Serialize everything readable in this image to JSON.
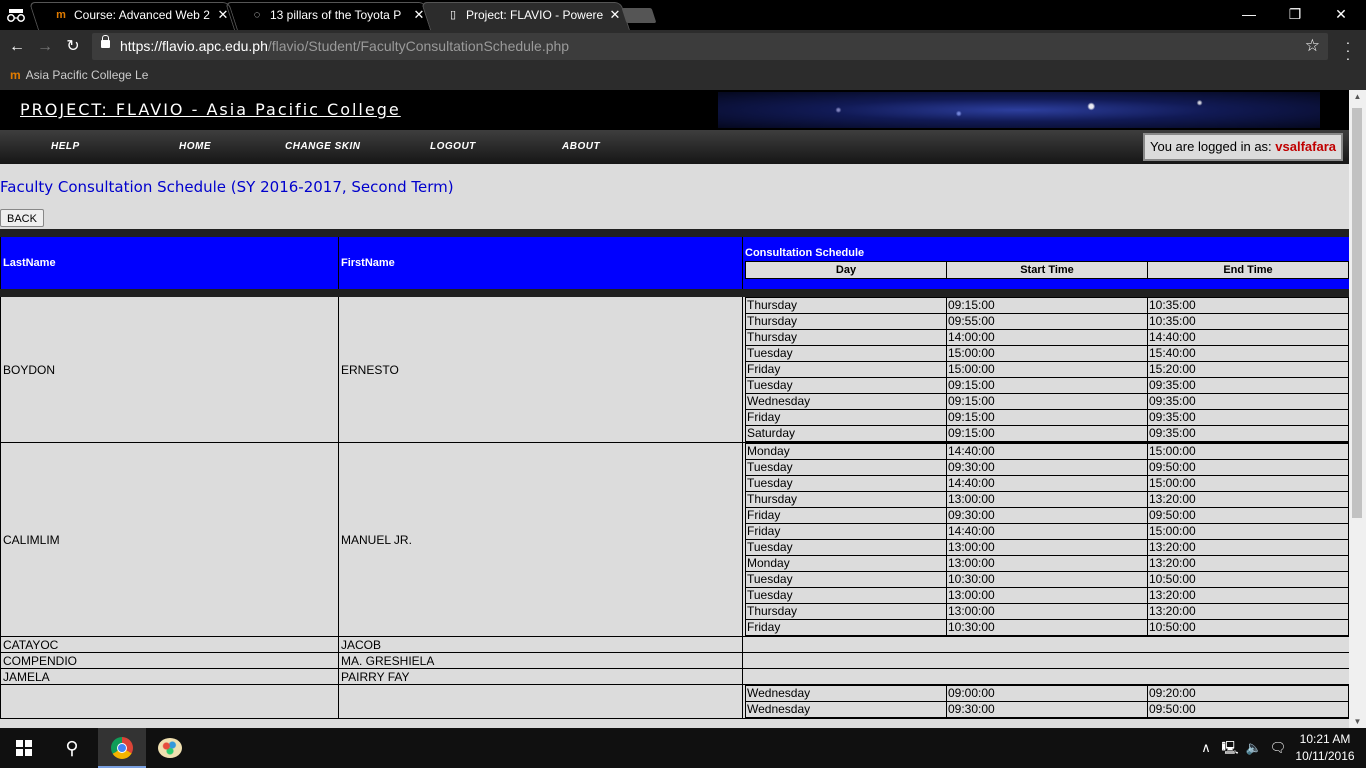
{
  "browser": {
    "tabs": [
      {
        "title": "Course: Advanced Web 2",
        "favicon": "moodle-icon"
      },
      {
        "title": "13 pillars of the Toyota P",
        "favicon": "loading-icon"
      },
      {
        "title": "Project: FLAVIO - Powere",
        "favicon": "page-icon"
      }
    ],
    "url_host": "https://flavio.apc.edu.ph",
    "url_path": "/flavio/Student/FacultyConsultationSchedule.php",
    "bookmark": "Asia Pacific College Le"
  },
  "site": {
    "title": "PROJECT: FLAVIO - Asia Pacific College",
    "nav": [
      "HELP",
      "HOME",
      "CHANGE SKIN",
      "LOGOUT",
      "ABOUT"
    ],
    "logged_label": "You are logged in as:",
    "username": "vsalfafara"
  },
  "page": {
    "heading": "Faculty Consultation Schedule (SY 2016-2017, Second Term)",
    "back_label": "BACK",
    "columns": {
      "last": "LastName",
      "first": "FirstName",
      "schedule": "Consultation Schedule"
    },
    "subcolumns": [
      "Day",
      "Start Time",
      "End Time"
    ]
  },
  "faculty": [
    {
      "last": "BOYDON",
      "first": "ERNESTO",
      "schedule": [
        [
          "Thursday",
          "09:15:00",
          "10:35:00"
        ],
        [
          "Thursday",
          "09:55:00",
          "10:35:00"
        ],
        [
          "Thursday",
          "14:00:00",
          "14:40:00"
        ],
        [
          "Tuesday",
          "15:00:00",
          "15:40:00"
        ],
        [
          "Friday",
          "15:00:00",
          "15:20:00"
        ],
        [
          "Tuesday",
          "09:15:00",
          "09:35:00"
        ],
        [
          "Wednesday",
          "09:15:00",
          "09:35:00"
        ],
        [
          "Friday",
          "09:15:00",
          "09:35:00"
        ],
        [
          "Saturday",
          "09:15:00",
          "09:35:00"
        ]
      ]
    },
    {
      "last": "CALIMLIM",
      "first": "MANUEL JR.",
      "schedule": [
        [
          "Monday",
          "14:40:00",
          "15:00:00"
        ],
        [
          "Tuesday",
          "09:30:00",
          "09:50:00"
        ],
        [
          "Tuesday",
          "14:40:00",
          "15:00:00"
        ],
        [
          "Thursday",
          "13:00:00",
          "13:20:00"
        ],
        [
          "Friday",
          "09:30:00",
          "09:50:00"
        ],
        [
          "Friday",
          "14:40:00",
          "15:00:00"
        ],
        [
          "Tuesday",
          "13:00:00",
          "13:20:00"
        ],
        [
          "Monday",
          "13:00:00",
          "13:20:00"
        ],
        [
          "Tuesday",
          "10:30:00",
          "10:50:00"
        ],
        [
          "Tuesday",
          "13:00:00",
          "13:20:00"
        ],
        [
          "Thursday",
          "13:00:00",
          "13:20:00"
        ],
        [
          "Friday",
          "10:30:00",
          "10:50:00"
        ]
      ]
    },
    {
      "last": "CATAYOC",
      "first": "JACOB",
      "schedule": []
    },
    {
      "last": "COMPENDIO",
      "first": "MA. GRESHIELA",
      "schedule": []
    },
    {
      "last": "JAMELA",
      "first": "PAIRRY FAY",
      "schedule": []
    },
    {
      "last": "",
      "first": "",
      "schedule": [
        [
          "Wednesday",
          "09:00:00",
          "09:20:00"
        ],
        [
          "Wednesday",
          "09:30:00",
          "09:50:00"
        ]
      ]
    }
  ],
  "taskbar": {
    "time": "10:21 AM",
    "date": "10/11/2016"
  }
}
